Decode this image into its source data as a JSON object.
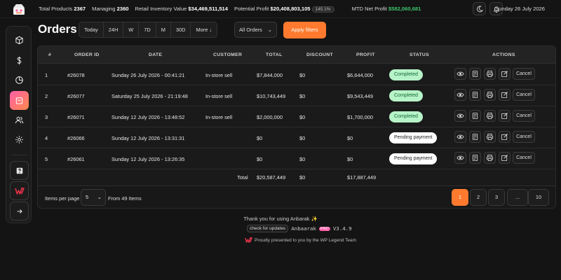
{
  "topbar": {
    "stats": [
      {
        "label": "Total Products",
        "value": "2367"
      },
      {
        "label": "Managing",
        "value": "2360"
      },
      {
        "label": "Retail Inventory Value",
        "value": "$34,469,511,514"
      },
      {
        "label": "Potential Profit",
        "value": "$20,408,803,105"
      },
      {
        "label": "MTD Net Profit",
        "value": "$582,060,681"
      }
    ],
    "profit_pct": "145.1%",
    "date": "Sunday 26 July 2026",
    "icons": [
      "moon-icon",
      "bell-icon"
    ]
  },
  "sidebar": {
    "items": [
      "cube-icon",
      "dollar-icon",
      "chart-pie-icon",
      "orders-bag-icon",
      "users-icon",
      "gear-icon"
    ],
    "active": "orders-bag-icon",
    "bottom": [
      "help-icon",
      "wp-legend-logo",
      "arrow-right-icon"
    ]
  },
  "page": {
    "title": "Orders",
    "ranges": [
      "Today",
      "24H",
      "W",
      "7D",
      "M",
      "30D",
      "More ↓"
    ],
    "filter_value": "All Orders",
    "apply_label": "Apply filters"
  },
  "table": {
    "headers": [
      "#",
      "ORDER ID",
      "DATE",
      "CUSTOMER",
      "TOTAL",
      "DISCOUNT",
      "PROFIT",
      "STATUS",
      "ACTIONS"
    ],
    "rows": [
      {
        "n": "1",
        "id": "#26078",
        "date": "Sunday 26 July 2026 - 00:41:21",
        "customer": "In-store sell",
        "total": "$7,844,000",
        "discount": "$0",
        "profit": "$6,644,000",
        "status": "Completed"
      },
      {
        "n": "2",
        "id": "#26077",
        "date": "Saturday 25 July 2026 - 21:19:48",
        "customer": "In-store sell",
        "total": "$10,743,449",
        "discount": "$0",
        "profit": "$9,543,449",
        "status": "Completed"
      },
      {
        "n": "3",
        "id": "#26071",
        "date": "Sunday 12 July 2026 - 13:48:52",
        "customer": "In-store sell",
        "total": "$2,000,000",
        "discount": "$0",
        "profit": "$1,700,000",
        "status": "Completed"
      },
      {
        "n": "4",
        "id": "#26066",
        "date": "Sunday 12 July 2026 - 13:31:31",
        "customer": "",
        "total": "$0",
        "discount": "$0",
        "profit": "$0",
        "status": "Pending payment"
      },
      {
        "n": "5",
        "id": "#26061",
        "date": "Sunday 12 July 2026 - 13:26:35",
        "customer": "",
        "total": "$0",
        "discount": "$0",
        "profit": "$0",
        "status": "Pending payment"
      }
    ],
    "cancel_label": "Cancel",
    "total_label": "Total",
    "total_total": "$20,587,449",
    "total_discount": "$0",
    "total_profit": "$17,887,449"
  },
  "pagination": {
    "per_page_label": "Items per page",
    "per_page_value": "5",
    "from_text": "From 49 Items",
    "pages": [
      "1",
      "2",
      "3",
      "...",
      "10"
    ],
    "active_page": "1"
  },
  "footer": {
    "thanks": "Thank you for using Anbarak ✨",
    "check_updates": "check for updates",
    "brand": "Anbaarak",
    "pro": "PRO",
    "version": "V3.4.9",
    "credit": "Proudly presented to you by the WP Legend Team"
  }
}
